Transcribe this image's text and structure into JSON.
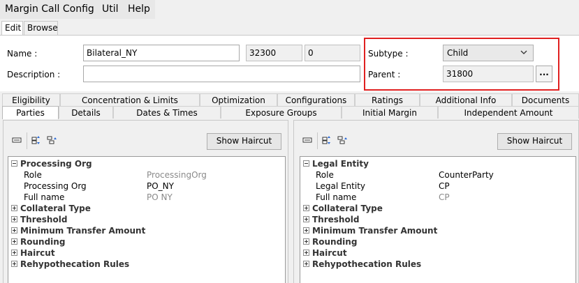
{
  "menu": [
    "Margin Call Config",
    "Util",
    "Help"
  ],
  "top_tabs": [
    "Edit",
    "Browse"
  ],
  "form": {
    "name_label": "Name :",
    "name_value": "Bilateral_NY",
    "id_value": "32300",
    "version_value": "0",
    "description_label": "Description :",
    "description_value": "",
    "subtype_label": "Subtype :",
    "subtype_value": "Child",
    "parent_label": "Parent :",
    "parent_value": "31800",
    "ellipsis_label": "..."
  },
  "tabs_row1": [
    "Eligibility",
    "Concentration & Limits",
    "Optimization",
    "Configurations",
    "Ratings",
    "Additional Info",
    "Documents"
  ],
  "tabs_row2": [
    "Parties",
    "Details",
    "Dates & Times",
    "Exposure Groups",
    "Initial Margin",
    "Independent Amount"
  ],
  "left_panel": {
    "button": "Show Haircut",
    "rows": [
      {
        "type": "section",
        "label": "Processing Org",
        "expanded": true
      },
      {
        "type": "field",
        "key": "Role",
        "value": "ProcessingOrg",
        "readonly": true
      },
      {
        "type": "field",
        "key": "Processing Org",
        "value": "PO_NY",
        "readonly": false
      },
      {
        "type": "field",
        "key": "Full name",
        "value": "PO NY",
        "readonly": true
      },
      {
        "type": "section",
        "label": "Collateral Type",
        "expanded": false
      },
      {
        "type": "section",
        "label": "Threshold",
        "expanded": false
      },
      {
        "type": "section",
        "label": "Minimum Transfer Amount",
        "expanded": false
      },
      {
        "type": "section",
        "label": "Rounding",
        "expanded": false
      },
      {
        "type": "section",
        "label": "Haircut",
        "expanded": false
      },
      {
        "type": "section",
        "label": "Rehypothecation Rules",
        "expanded": false
      }
    ]
  },
  "right_panel": {
    "button": "Show Haircut",
    "rows": [
      {
        "type": "section",
        "label": "Legal Entity",
        "expanded": true
      },
      {
        "type": "field",
        "key": "Role",
        "value": "CounterParty",
        "readonly": false
      },
      {
        "type": "field",
        "key": "Legal Entity",
        "value": "CP",
        "readonly": false
      },
      {
        "type": "field",
        "key": "Full name",
        "value": "CP",
        "readonly": true
      },
      {
        "type": "section",
        "label": "Collateral Type",
        "expanded": false
      },
      {
        "type": "section",
        "label": "Threshold",
        "expanded": false
      },
      {
        "type": "section",
        "label": "Minimum Transfer Amount",
        "expanded": false
      },
      {
        "type": "section",
        "label": "Rounding",
        "expanded": false
      },
      {
        "type": "section",
        "label": "Haircut",
        "expanded": false
      },
      {
        "type": "section",
        "label": "Rehypothecation Rules",
        "expanded": false
      }
    ]
  },
  "colors": {
    "highlight_box": "#e02020",
    "readonly_text": "#8a8a8a"
  }
}
